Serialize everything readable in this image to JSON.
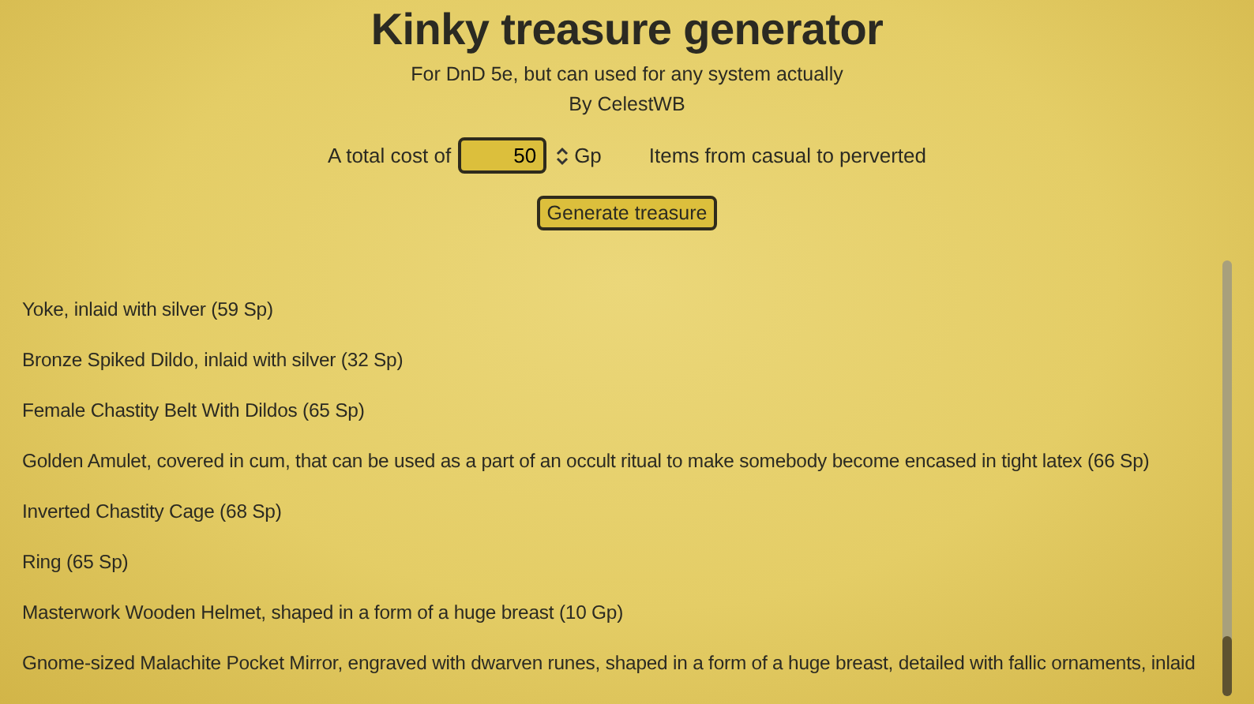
{
  "title": "Kinky treasure generator",
  "subtitle": "For DnD 5e, but can used for any system actually",
  "author": "By CelestWB",
  "cost": {
    "label": "A total cost of",
    "value": "50",
    "unit": "Gp"
  },
  "range_label": "Items from casual to perverted",
  "generate_button": "Generate treasure",
  "items": [
    "Yoke, inlaid with silver (59 Sp)",
    "Bronze Spiked Dildo, inlaid with silver (32 Sp)",
    "Female Chastity Belt With Dildos (65 Sp)",
    "Golden Amulet, covered in cum, that can be used as a part of an occult ritual to make somebody become encased in tight latex (66 Sp)",
    "Inverted Chastity Cage (68 Sp)",
    "Ring (65 Sp)",
    "Masterwork Wooden Helmet, shaped in a form of a huge breast (10 Gp)",
    "Gnome-sized Malachite Pocket Mirror, engraved with dwarven runes, shaped in a form of a huge breast, detailed with fallic ornaments, inlaid"
  ]
}
